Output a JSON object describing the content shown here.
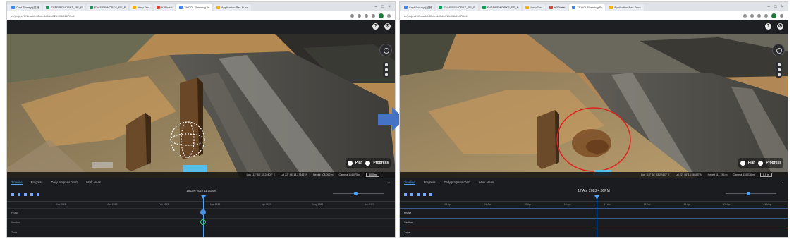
{
  "left": {
    "browser_tabs": [
      "Cost Survey (混凝",
      "EVAFIREWORKS_RE_P",
      "EVAFIREWORKS_RE_P",
      "Help Test",
      "K3Portal",
      "XKOOL Planning Pr",
      "Application Res Succ"
    ],
    "address": "er/project/1f9eaab0-55de-4d5d-a721-53b5187f9c4",
    "status": {
      "lon": "Lon 113° 58' 33.22402\" E",
      "lat": "Lat 22° 46' 14.27446\" N",
      "height": "Height 108.092 m",
      "camera": "Camera 114.075 m",
      "scale": "50.0 m"
    },
    "toggle": {
      "plan": "Plan",
      "progress": "Progress"
    },
    "panel_tabs": [
      "Timeline",
      "Progress",
      "Daily progress chart",
      "Work areas"
    ],
    "timeline_date": "16 Dec 2022 11:00AM",
    "ruler": [
      "Dec 2022",
      "Jan 2023",
      "Feb 2023",
      "Mar 2023",
      "Apr 2023",
      "May 2023",
      "Jun 2023"
    ],
    "lanes": [
      "Phase",
      "Section",
      "Zone"
    ]
  },
  "right": {
    "browser_tabs": [
      "Cost Survey (混凝",
      "EVAFIREWORKS_RE_P",
      "EVAFIREWORKS_RE_P",
      "Help Test",
      "K3Portal",
      "XKOOL Planning Pr",
      "Application Res Succ"
    ],
    "address": "er/project/1f9eaab0-55de-4d5d-a721-53b5187f9c4",
    "status": {
      "lon": "Lon 113° 58' 33.22403\" E",
      "lat": "Lat 22° 46' 14.08685\" N",
      "height": "Height 111.786 m",
      "camera": "Camera 114.076 m",
      "scale": "5.0 m"
    },
    "toggle": {
      "plan": "Plan",
      "progress": "Progress"
    },
    "panel_tabs": [
      "Timeline",
      "Progress",
      "Daily progress chart",
      "Work areas"
    ],
    "timeline_date": "17 Apr 2023 4:30PM",
    "ruler": [
      "03 Apr",
      "06 Apr",
      "10 Apr",
      "13 Apr",
      "17 Apr",
      "20 Apr",
      "24 Apr",
      "27 Apr",
      "01 May"
    ],
    "lanes": [
      "Phase",
      "Section",
      "Zone"
    ]
  },
  "colors": {
    "arrow": "#4472c4",
    "highlight_circle": "#e02020",
    "accent": "#4aa3ff"
  }
}
